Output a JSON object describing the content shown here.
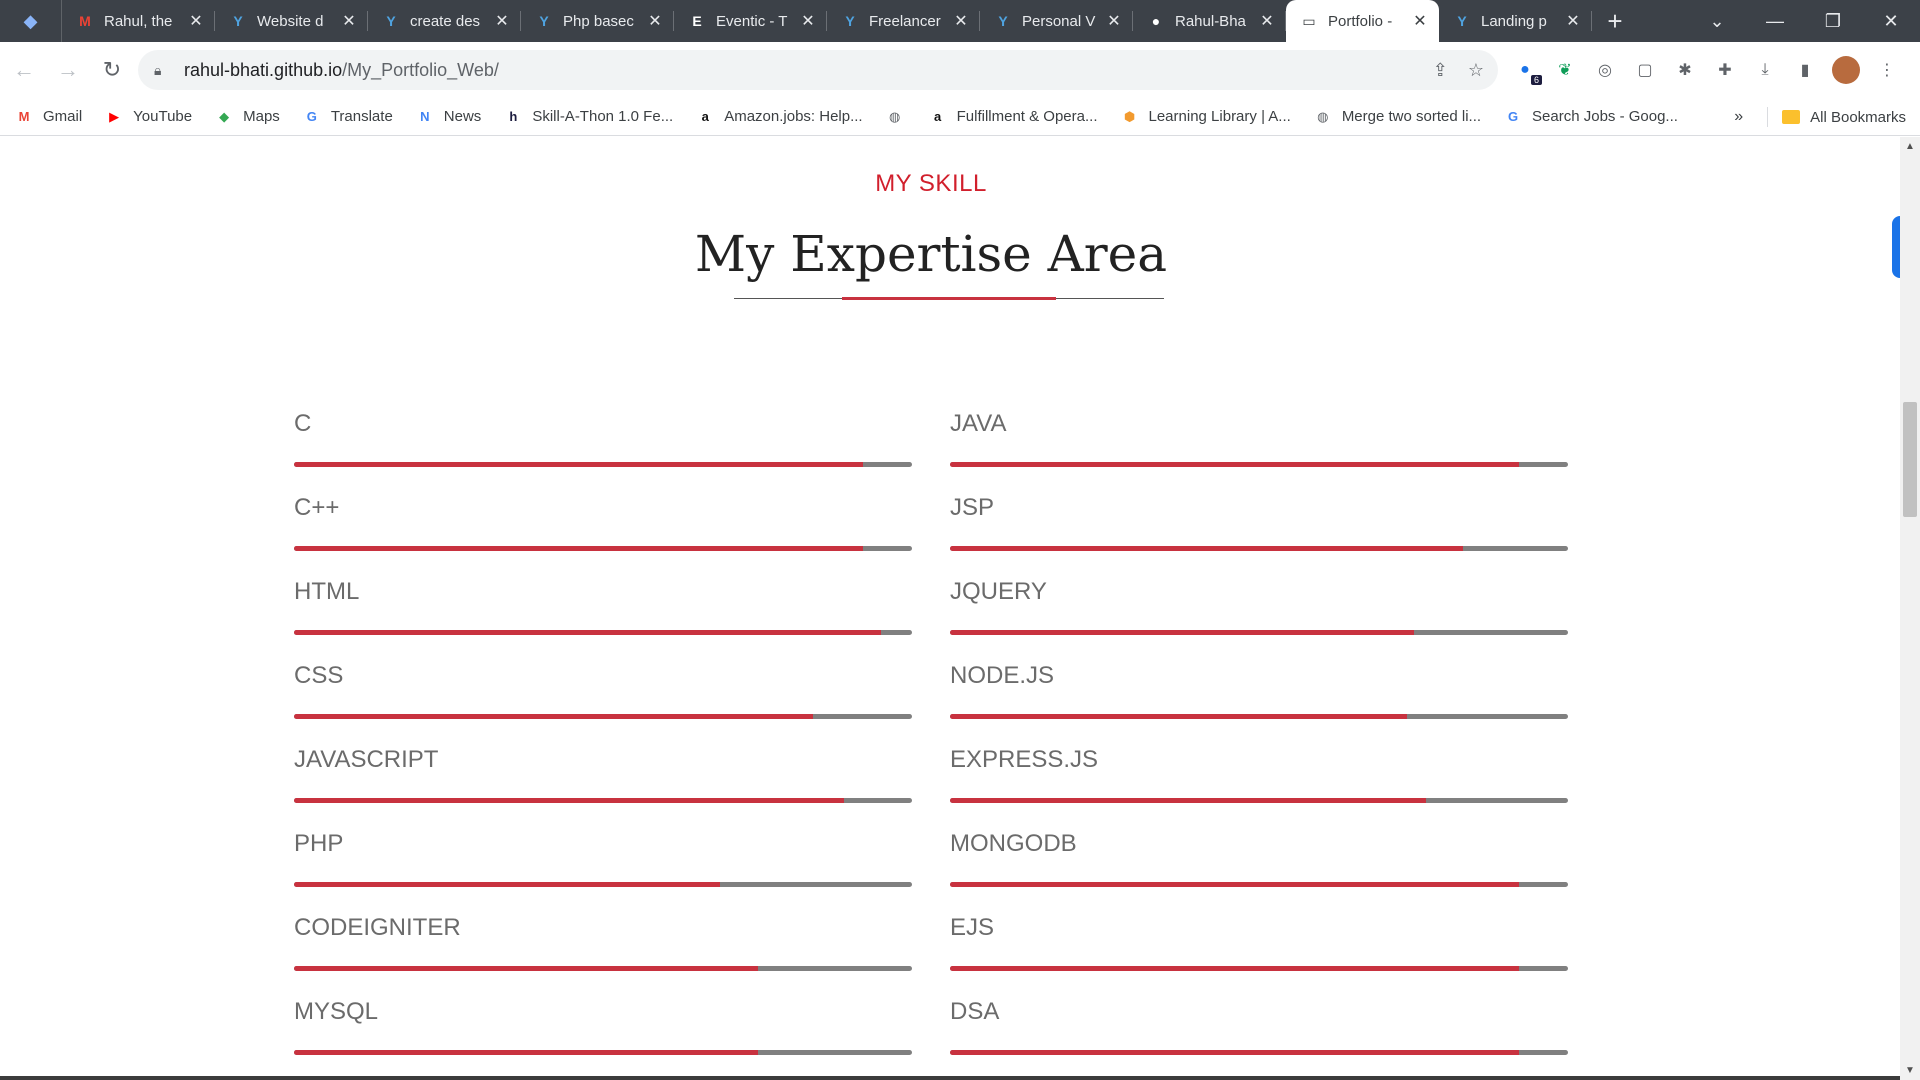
{
  "browser": {
    "tabs": [
      {
        "title": "Rahul, the",
        "fav": "M",
        "fav_color": "#ea4335"
      },
      {
        "title": "Website d",
        "fav": "Y",
        "fav_color": "#4fa3e0"
      },
      {
        "title": "create des",
        "fav": "Y",
        "fav_color": "#4fa3e0"
      },
      {
        "title": "Php basec",
        "fav": "Y",
        "fav_color": "#4fa3e0"
      },
      {
        "title": "Eventic - T",
        "fav": "E",
        "fav_color": "#ffffff"
      },
      {
        "title": "Freelancer",
        "fav": "Y",
        "fav_color": "#4fa3e0"
      },
      {
        "title": "Personal V",
        "fav": "Y",
        "fav_color": "#4fa3e0"
      },
      {
        "title": "Rahul-Bha",
        "fav": "●",
        "fav_color": "#ffffff"
      },
      {
        "title": "Portfolio -",
        "fav": "▭",
        "fav_color": "#3c4043",
        "active": true
      },
      {
        "title": "Landing p",
        "fav": "Y",
        "fav_color": "#4fa3e0"
      }
    ],
    "url_host": "rahul-bhati.github.io",
    "url_path": "/My_Portfolio_Web/",
    "extension_badge": "6"
  },
  "bookmarks": [
    {
      "label": "Gmail",
      "icon": "M",
      "color": "#ea4335"
    },
    {
      "label": "YouTube",
      "icon": "▶",
      "color": "#ff0000"
    },
    {
      "label": "Maps",
      "icon": "◆",
      "color": "#34a853"
    },
    {
      "label": "Translate",
      "icon": "G",
      "color": "#4285f4"
    },
    {
      "label": "News",
      "icon": "N",
      "color": "#4285f4"
    },
    {
      "label": "Skill-A-Thon 1.0 Fe...",
      "icon": "h",
      "color": "#1d1d3f"
    },
    {
      "label": "Amazon.jobs: Help...",
      "icon": "a",
      "color": "#111111"
    },
    {
      "label": "",
      "icon": "◍",
      "color": "#5f6368"
    },
    {
      "label": "Fulfillment & Opera...",
      "icon": "a",
      "color": "#111111"
    },
    {
      "label": "Learning Library | A...",
      "icon": "⬢",
      "color": "#f29a2e"
    },
    {
      "label": "Merge two sorted li...",
      "icon": "◍",
      "color": "#5f6368"
    },
    {
      "label": "Search Jobs - Goog...",
      "icon": "G",
      "color": "#4285f4"
    }
  ],
  "bookmarks_more": "»",
  "all_bookmarks": "All Bookmarks",
  "page": {
    "kicker": "MY SKILL",
    "heading": "My Expertise Area",
    "accent_color": "#c8323f",
    "skills_left": [
      {
        "name": "C",
        "level": 0.92
      },
      {
        "name": "C++",
        "level": 0.92
      },
      {
        "name": "HTML",
        "level": 0.95
      },
      {
        "name": "CSS",
        "level": 0.84
      },
      {
        "name": "JAVASCRIPT",
        "level": 0.89
      },
      {
        "name": "PHP",
        "level": 0.69
      },
      {
        "name": "CODEIGNITER",
        "level": 0.75
      },
      {
        "name": "MYSQL",
        "level": 0.75
      }
    ],
    "skills_right": [
      {
        "name": "JAVA",
        "level": 0.92
      },
      {
        "name": "JSP",
        "level": 0.83
      },
      {
        "name": "JQUERY",
        "level": 0.75
      },
      {
        "name": "NODE.JS",
        "level": 0.74
      },
      {
        "name": "EXPRESS.JS",
        "level": 0.77
      },
      {
        "name": "MONGODB",
        "level": 0.92
      },
      {
        "name": "EJS",
        "level": 0.92
      },
      {
        "name": "DSA",
        "level": 0.92
      }
    ]
  }
}
